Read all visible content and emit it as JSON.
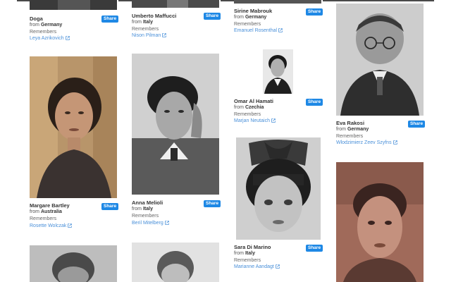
{
  "labels": {
    "from": "from",
    "remembers": "Remembers",
    "share": "Share"
  },
  "cards": [
    {
      "name": "Doga",
      "country": "Germany",
      "rememberer": "Leya Azrikovich"
    },
    {
      "name": "Umberto Maffucci",
      "country": "Italy",
      "rememberer": "Nison Pilman"
    },
    {
      "name": "Sirine Mabrouk",
      "country": "Germany",
      "rememberer": "Emanuel Rosenthal"
    },
    {
      "name": "Eva Rakosi",
      "country": "Germany",
      "rememberer": "Wlodzimierz Zeev Szyfns"
    },
    {
      "name": "Margare Bartley",
      "country": "Australia",
      "rememberer": "Rosette Wolczak"
    },
    {
      "name": "Anna Melioli",
      "country": "Italy",
      "rememberer": "Beril Mitelberg"
    },
    {
      "name": "Omar Al Hamati",
      "country": "Czechia",
      "rememberer": "Marjan Neutaich"
    },
    {
      "name": "Sara Di Marino",
      "country": "Italy",
      "rememberer": "Marianne Aandagt"
    }
  ]
}
